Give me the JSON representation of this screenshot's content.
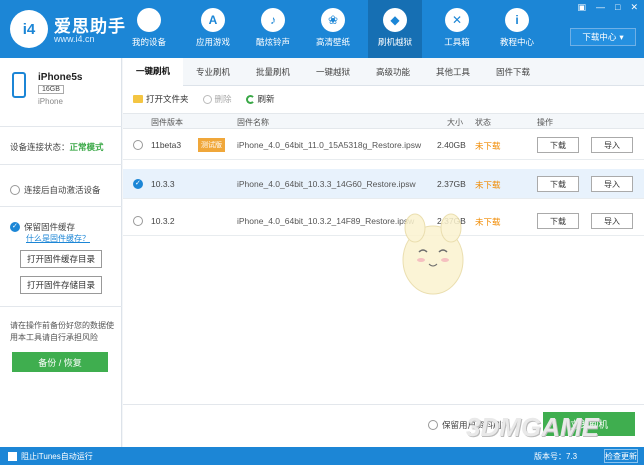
{
  "header": {
    "logo_mark": "i4",
    "app_name": "爱思助手",
    "url": "www.i4.cn",
    "nav": [
      {
        "label": "我的设备",
        "icon": "apple-icon",
        "glyph": ""
      },
      {
        "label": "应用游戏",
        "icon": "app-store-icon",
        "glyph": "A"
      },
      {
        "label": "酷炫铃声",
        "icon": "bell-icon",
        "glyph": "♪"
      },
      {
        "label": "高清壁纸",
        "icon": "wallpaper-icon",
        "glyph": "❀"
      },
      {
        "label": "刷机越狱",
        "icon": "dropbox-icon",
        "glyph": "◆"
      },
      {
        "label": "工具箱",
        "icon": "tools-icon",
        "glyph": "✕"
      },
      {
        "label": "教程中心",
        "icon": "info-icon",
        "glyph": "i"
      }
    ],
    "active_nav": 4,
    "window_controls": [
      "▣",
      "—",
      "□",
      "✕"
    ],
    "download_center": "下载中心"
  },
  "device": {
    "name": "iPhone5s",
    "capacity": "16GB",
    "type": "iPhone"
  },
  "sidebar": {
    "conn_label": "设备连接状态：",
    "conn_value": "正常模式",
    "auto_activate": "连接后自动激活设备",
    "keep_firmware_cache": "保留固件缓存",
    "what_is_cache": "什么是固件缓存？",
    "open_cache_dir": "打开固件缓存目录",
    "open_store_dir": "打开固件存储目录",
    "note": "请在操作前备份好您的数据使用本工具请自行承担风险",
    "backup_button": "备份 / 恢复"
  },
  "tabs": [
    "一键刷机",
    "专业刷机",
    "批量刷机",
    "一键越狱",
    "高级功能",
    "其他工具",
    "固件下载"
  ],
  "toolbar": {
    "open_folder": "打开文件夹",
    "delete": "删除",
    "refresh": "刷新"
  },
  "table": {
    "headers": {
      "version": "固件版本",
      "name": "固件名称",
      "size": "大小",
      "status": "状态",
      "actions": "操作"
    },
    "rows": [
      {
        "version": "11beta3",
        "tag": "测试版",
        "name": "iPhone_4.0_64bit_11.0_15A5318g_Restore.ipsw",
        "size": "2.40GB",
        "status": "未下载",
        "download": "下载",
        "import": "导入",
        "selected": false
      },
      {
        "version": "10.3.3",
        "tag": "",
        "name": "iPhone_4.0_64bit_10.3.3_14G60_Restore.ipsw",
        "size": "2.37GB",
        "status": "未下载",
        "download": "下载",
        "import": "导入",
        "selected": true
      },
      {
        "version": "10.3.2",
        "tag": "",
        "name": "iPhone_4.0_64bit_10.3.2_14F89_Restore.ipsw",
        "size": "2.37GB",
        "status": "未下载",
        "download": "下载",
        "import": "导入",
        "selected": false
      }
    ]
  },
  "bottom": {
    "keep_user_data": "保留用户资料刷机",
    "flash_button": "立即刷机"
  },
  "statusbar": {
    "block_itunes": "阻止iTunes自动运行",
    "version": "版本号：7.3",
    "check_update": "检查更新"
  },
  "watermark": "3DMGAME",
  "colors": {
    "primary": "#1c86d6",
    "success": "#3fae4f",
    "warning": "#f08a00"
  }
}
